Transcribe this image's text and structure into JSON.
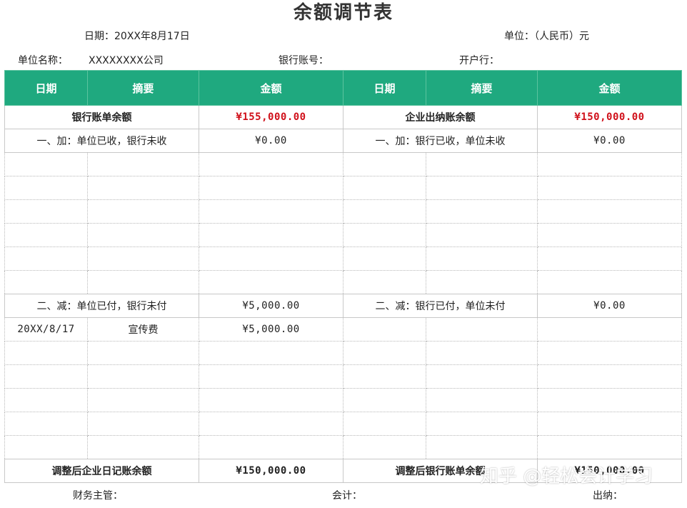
{
  "title": "余额调节表",
  "meta": {
    "date": "日期：20XX年8月17日",
    "unit": "单位：（人民币）元",
    "company_label": "单位名称：",
    "company_value": "XXXXXXXX公司",
    "account_label": "银行账号：",
    "bank_label": "开户行："
  },
  "headers": [
    "日期",
    "摘要",
    "金额",
    "日期",
    "摘要",
    "金额"
  ],
  "balances": {
    "left_label": "银行账单余额",
    "left_value": "¥155,000.00",
    "right_label": "企业出纳账余额",
    "right_value": "¥150,000.00"
  },
  "add_section": {
    "left_label": "一、加：单位已收，银行未收",
    "left_value": "¥0.00",
    "right_label": "一、加：银行已收，单位未收",
    "right_value": "¥0.00"
  },
  "sub_section": {
    "left_label": "二、减：单位已付，银行未付",
    "left_value": "¥5,000.00",
    "right_label": "二、减：银行已付，单位未付",
    "right_value": "¥0.00"
  },
  "sub_row": {
    "date": "20XX/8/17",
    "summary": "宣传费",
    "amount": "¥5,000.00"
  },
  "adjusted": {
    "left_label": "调整后企业日记账余额",
    "left_value": "¥150,000.00",
    "right_label": "调整后银行账单余额",
    "right_value": "¥150,000.00"
  },
  "footer": {
    "manager": "财务主管：",
    "accountant": "会计：",
    "cashier": "出纳："
  },
  "watermark": "知乎 @轻松会计学习",
  "colors": {
    "header_bg": "#1fa97f",
    "highlight": "#d0101a"
  }
}
